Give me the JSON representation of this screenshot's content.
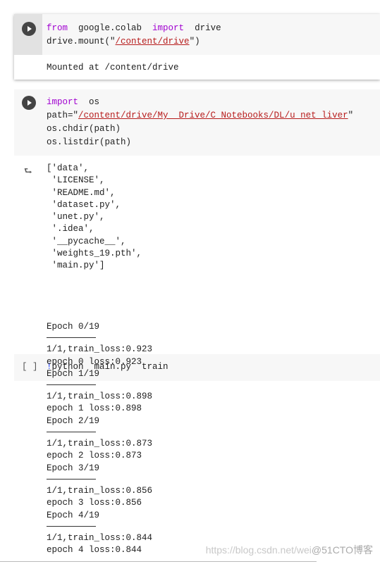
{
  "cell1": {
    "code": [
      {
        "parts": [
          [
            "kw",
            "from"
          ],
          [
            "",
            "  google.colab  "
          ],
          [
            "kw",
            "import"
          ],
          [
            "",
            "  drive"
          ]
        ]
      },
      {
        "parts": [
          [
            "",
            "drive.mount(\""
          ],
          [
            "str",
            "/content/drive"
          ],
          [
            "",
            "\")"
          ]
        ]
      }
    ],
    "output": "Mounted at /content/drive"
  },
  "cell2": {
    "code": [
      {
        "parts": [
          [
            "kw",
            "import"
          ],
          [
            "",
            "  os"
          ]
        ]
      },
      {
        "parts": [
          [
            "",
            "path=\""
          ],
          [
            "str",
            "/content/drive/My  Drive/C_Notebooks/DL/u_net_liver"
          ],
          [
            "",
            "\""
          ]
        ]
      },
      {
        "parts": [
          [
            "",
            "os.chdir(path)"
          ]
        ]
      },
      {
        "parts": [
          [
            "",
            "os.listdir(path)"
          ]
        ]
      }
    ],
    "output": [
      "['data',",
      " 'LICENSE',",
      " 'README.md',",
      " 'dataset.py',",
      " 'unet.py',",
      " '.idea',",
      " '__pycache__',",
      " 'weights_19.pth',",
      " 'main.py']"
    ]
  },
  "cell3": {
    "run_label": "[ ]",
    "code_bang": "!",
    "code": "python  main.py  train",
    "epochs": [
      {
        "header": "Epoch 0/19",
        "train": "1/1,train_loss:0.923",
        "loss": "epoch 0 loss:0.923"
      },
      {
        "header": "Epoch 1/19",
        "train": "1/1,train_loss:0.898",
        "loss": "epoch 1 loss:0.898"
      },
      {
        "header": "Epoch 2/19",
        "train": "1/1,train_loss:0.873",
        "loss": "epoch 2 loss:0.873"
      },
      {
        "header": "Epoch 3/19",
        "train": "1/1,train_loss:0.856",
        "loss": "epoch 3 loss:0.856"
      },
      {
        "header": "Epoch 4/19",
        "train": "1/1,train_loss:0.844",
        "loss": "epoch 4 loss:0.844"
      }
    ]
  },
  "watermark": {
    "url": "https://blog.csdn.net/wei",
    "brand": "@51CTO博客"
  }
}
